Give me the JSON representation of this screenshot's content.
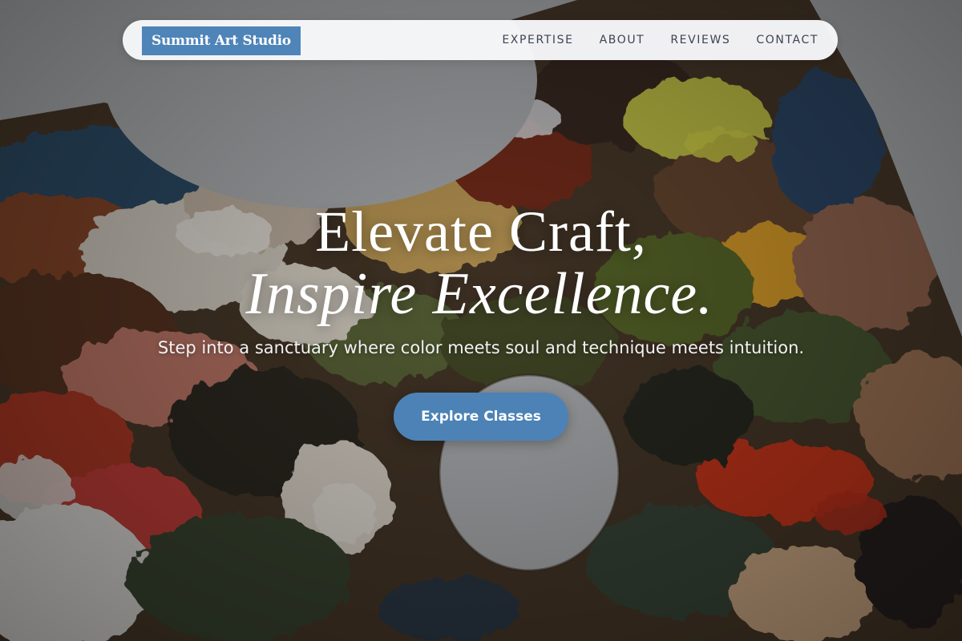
{
  "nav": {
    "brand": "Summit Art Studio",
    "links": [
      "EXPERTISE",
      "ABOUT",
      "REVIEWS",
      "CONTACT"
    ]
  },
  "hero": {
    "headline_line1": "Elevate Craft,",
    "headline_line2": "Inspire Excellence.",
    "subtitle": "Step into a sanctuary where color meets soul and technique meets intuition.",
    "cta_label": "Explore Classes"
  },
  "colors": {
    "accent": "#4c82b6",
    "nav_background": "#f8f9fb",
    "nav_text": "#3c4452",
    "headline_text": "#ffffff"
  },
  "background": {
    "subject": "paint palette with thick oil paint strokes"
  }
}
